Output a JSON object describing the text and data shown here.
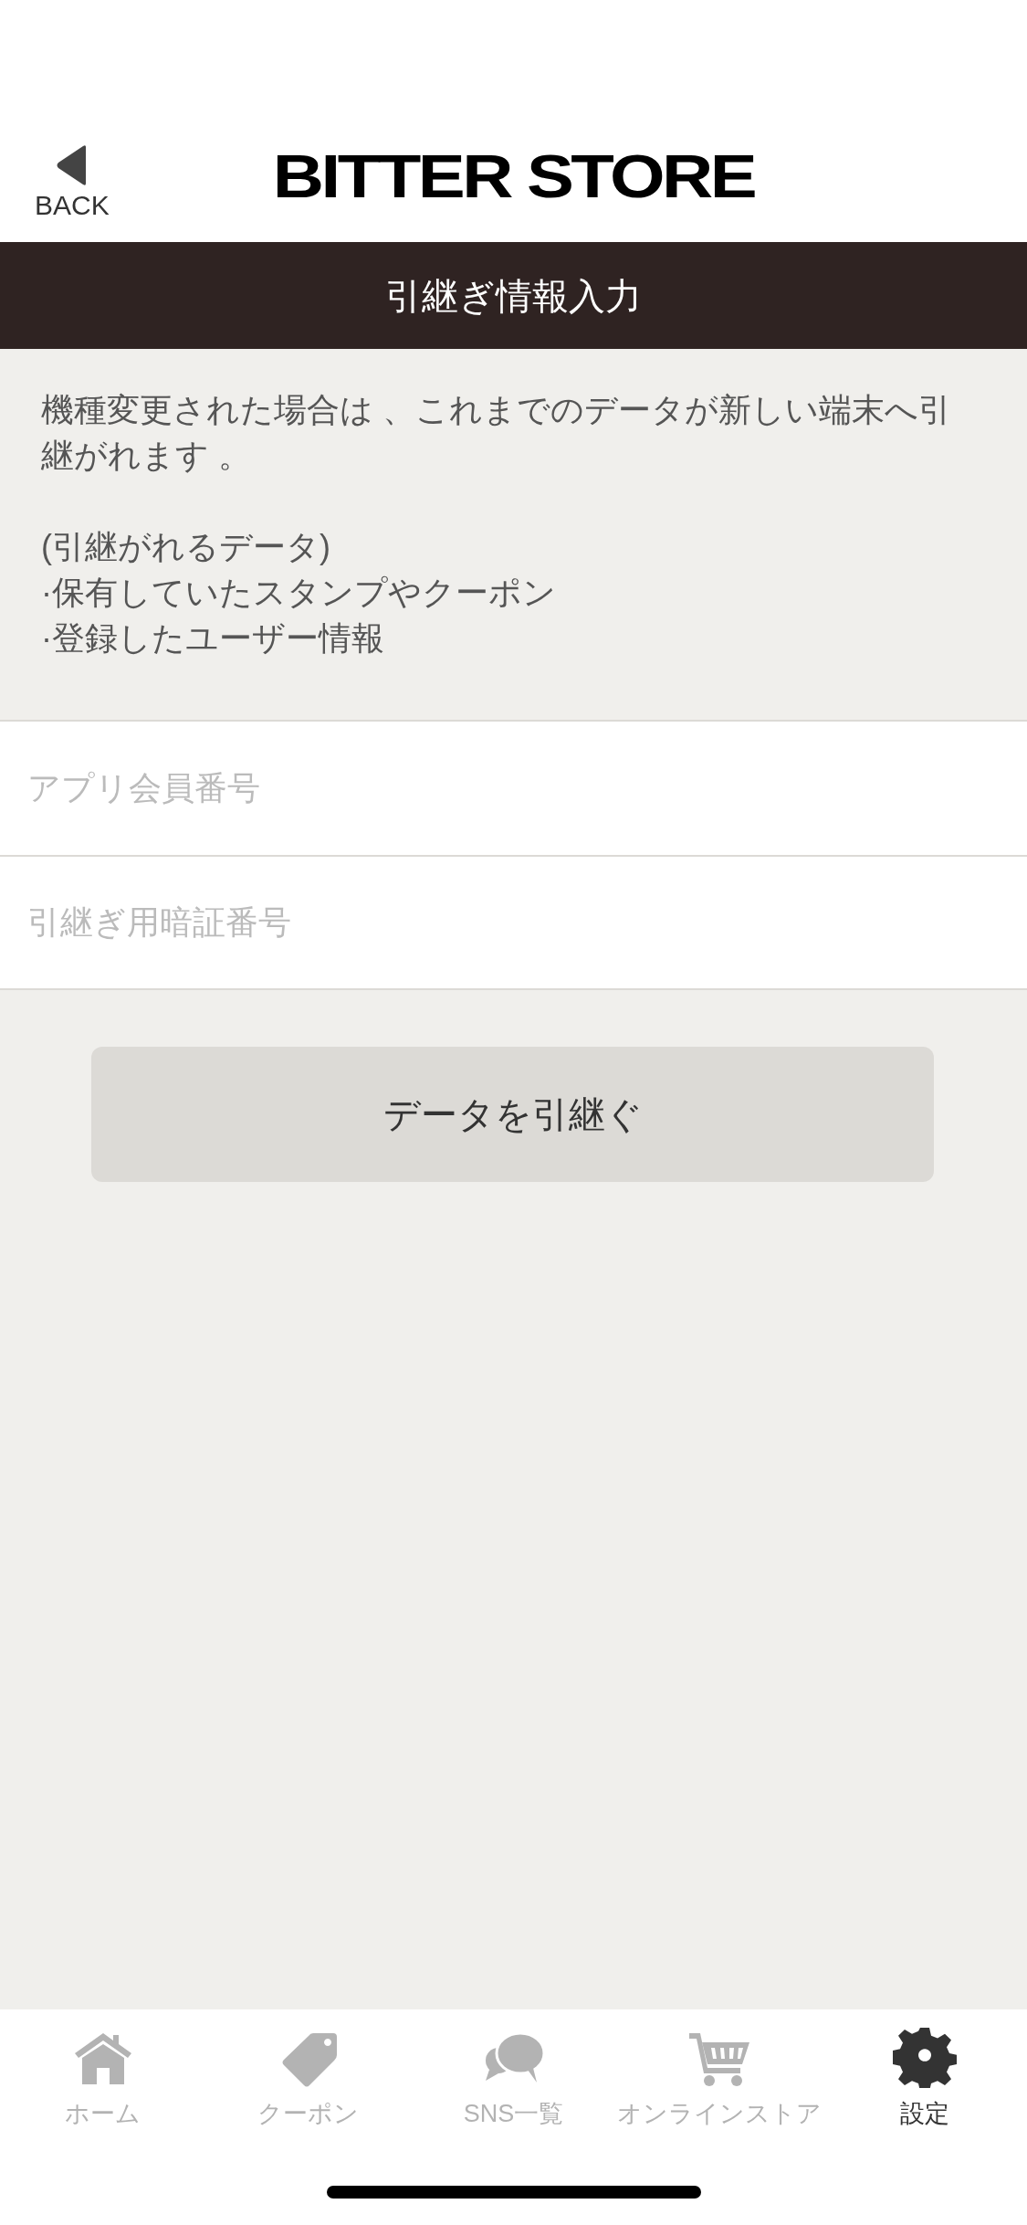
{
  "header": {
    "back_label": "BACK",
    "logo": "BITTER STORE"
  },
  "title": "引継ぎ情報入力",
  "info": {
    "intro": "機種変更された場合は 、これまでのデータが新しい端末へ引継がれます 。",
    "list_heading": "(引継がれるデータ)",
    "items": [
      "·保有していたスタンプやクーポン",
      "·登録したユーザー情報"
    ]
  },
  "fields": [
    {
      "placeholder": "アプリ会員番号"
    },
    {
      "placeholder": "引継ぎ用暗証番号"
    }
  ],
  "submit_button": "データを引継ぐ",
  "tab_bar": [
    {
      "label": "ホーム",
      "kind": "home",
      "selected": false
    },
    {
      "label": "クーポン",
      "kind": "tag",
      "selected": false
    },
    {
      "label": "SNS一覧",
      "kind": "chat",
      "selected": false
    },
    {
      "label": "オンラインストア",
      "kind": "cart",
      "selected": false
    },
    {
      "label": "設定",
      "kind": "gear",
      "selected": true
    }
  ]
}
